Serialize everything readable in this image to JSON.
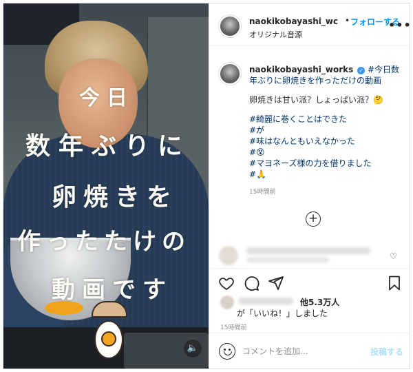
{
  "post": {
    "author": "naokikobayashi_wc",
    "separator": "•",
    "follow_label": "フォローする",
    "audio": "オリジナル音源",
    "more": "•••"
  },
  "video": {
    "caption_lines": [
      "今日",
      "数年ぶりに",
      "卵焼きを",
      "作ったたけの",
      "動画です"
    ],
    "mute_icon": "speaker-muted-icon"
  },
  "caption": {
    "username": "naokikobayashi_works",
    "first_line": "#今日数年ぶりに卵焼きを作っただけの動画",
    "question": "卵焼きは甘い派？しょっぱい派？🤔",
    "tags": [
      "#綺麗に巻くことはできた",
      "#が",
      "#味はなんともいえなかった",
      "#😵",
      "#マヨネーズ様の力を借りました",
      "#🙏"
    ],
    "time": "15時間前"
  },
  "likes": {
    "count": "他5.3万人",
    "suffix": "が「いいね！」しました"
  },
  "timestamp": "15時間前",
  "comment_box": {
    "placeholder": "コメントを追加...",
    "post_label": "投稿する"
  },
  "colors": {
    "link_blue": "#0095f6",
    "hashtag": "#00376b",
    "muted_text": "#8e8e8e",
    "post_disabled": "#b2dffc"
  }
}
